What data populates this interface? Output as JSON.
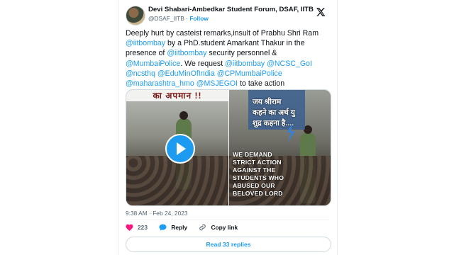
{
  "author": {
    "display_name": "Devi Shabari-Ambedkar Student Forum, DSAF, IITB",
    "handle": "@DSAF_IITB",
    "separator": " · ",
    "follow_label": "Follow"
  },
  "tweet": {
    "lines": [
      [
        {
          "t": "Deeply hurt by casteist remarks,insult of Prabhu Shri Ram",
          "m": false
        }
      ],
      [
        {
          "t": "@iitbombay",
          "m": true
        },
        {
          "t": " by a PhD.student Amarkant Thakur in the",
          "m": false
        }
      ],
      [
        {
          "t": "presence of ",
          "m": false
        },
        {
          "t": "@iitbombay",
          "m": true
        },
        {
          "t": " security personnel &",
          "m": false
        }
      ],
      [
        {
          "t": "@MumbaiPolice",
          "m": true
        },
        {
          "t": ". We request ",
          "m": false
        },
        {
          "t": "@iitbombay",
          "m": true
        },
        {
          "t": " ",
          "m": false
        },
        {
          "t": "@NCSC_GoI",
          "m": true
        }
      ],
      [
        {
          "t": "@ncsthq",
          "m": true
        },
        {
          "t": " ",
          "m": false
        },
        {
          "t": "@EduMinOfIndia",
          "m": true
        },
        {
          "t": " ",
          "m": false
        },
        {
          "t": "@CPMumbaiPolice",
          "m": true
        }
      ],
      [
        {
          "t": "@maharashtra_hmo",
          "m": true
        },
        {
          "t": " ",
          "m": false
        },
        {
          "t": "@MSJEGOI",
          "m": true
        },
        {
          "t": " to take action",
          "m": false
        }
      ]
    ]
  },
  "media": {
    "left_banner": "का अपमान !!",
    "hindi_caption": [
      "जय श्रीराम",
      "कहने का अर्थ यु",
      "शुद्र कहना है...."
    ],
    "demand_text": "WE DEMAND STRICT ACTION AGAINST THE STUDENTS WHO ABUSED OUR BELOVED LORD",
    "play_icon": "play-icon"
  },
  "meta": {
    "time": "9:38 AM",
    "separator": " · ",
    "date": "Feb 24, 2023"
  },
  "actions": {
    "likes": "223",
    "reply_label": "Reply",
    "copy_label": "Copy link"
  },
  "replies_button": "Read 33 replies",
  "colors": {
    "accent": "#1d9bf0",
    "like": "#f91880",
    "text": "#0f1419",
    "muted": "#536471"
  }
}
